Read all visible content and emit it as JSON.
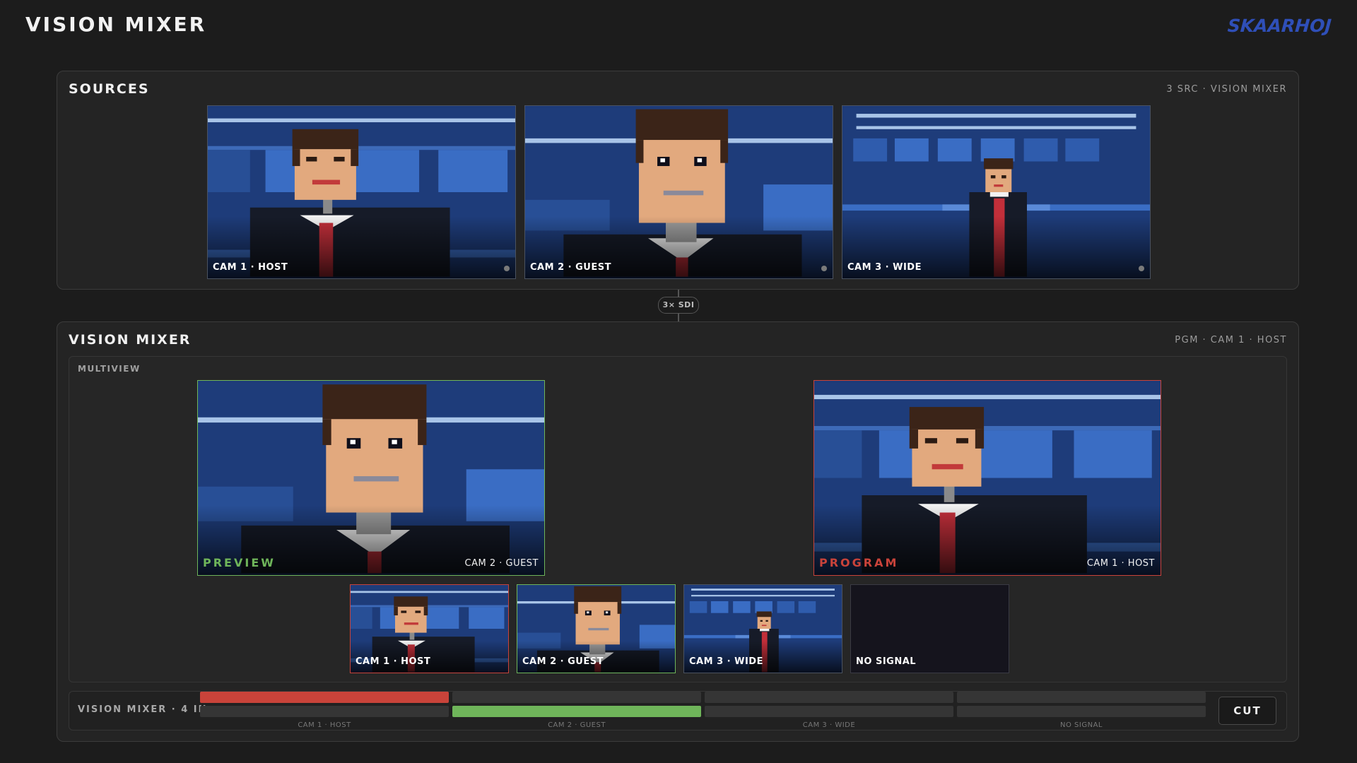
{
  "app": {
    "title": "VISION MIXER",
    "brand": "SKAARHOJ"
  },
  "sources": {
    "title": "SOURCES",
    "meta": "3 SRC · VISION MIXER",
    "cams": [
      {
        "label": "CAM 1 · HOST"
      },
      {
        "label": "CAM 2 · GUEST"
      },
      {
        "label": "CAM 3 · WIDE"
      }
    ]
  },
  "link": {
    "label": "3× SDI"
  },
  "mixer": {
    "title": "VISION MIXER",
    "meta": "PGM · CAM 1 · HOST",
    "multiview": {
      "title": "MULTIVIEW",
      "preview": {
        "label": "PREVIEW",
        "source": "CAM 2 · GUEST",
        "color": "#6fb55a"
      },
      "program": {
        "label": "PROGRAM",
        "source": "CAM 1 · HOST",
        "color": "#c9433a"
      },
      "tiles": [
        {
          "label": "CAM 1 · HOST"
        },
        {
          "label": "CAM 2 · GUEST"
        },
        {
          "label": "CAM 3 · WIDE"
        },
        {
          "label": "NO SIGNAL"
        }
      ]
    },
    "bus": {
      "title": "VISION MIXER · 4 IN",
      "inputs": [
        "CAM 1 · HOST",
        "CAM 2 · GUEST",
        "CAM 3 · WIDE",
        "NO SIGNAL"
      ],
      "program_index": 0,
      "preview_index": 1,
      "cut_label": "CUT"
    }
  },
  "colors": {
    "program": "#c9433a",
    "preview": "#6fb55a",
    "brand": "#2f4fb8"
  },
  "icons": [
    "tally-dot-icon"
  ]
}
